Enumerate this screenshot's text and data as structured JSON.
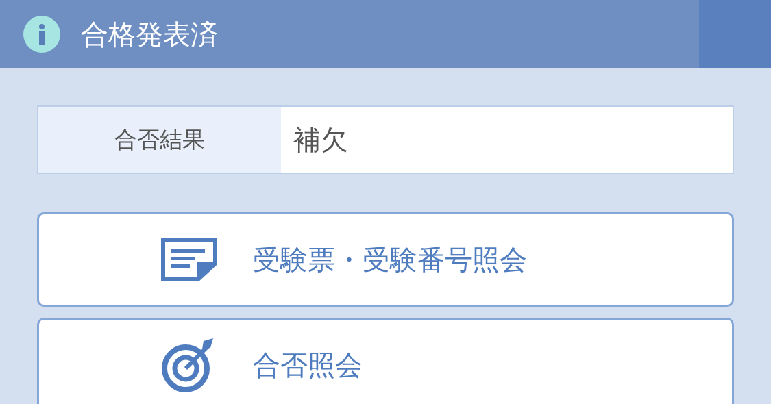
{
  "header": {
    "title": "合格発表済"
  },
  "result": {
    "label": "合否結果",
    "value": "補欠"
  },
  "buttons": [
    {
      "kind": "ticket",
      "label": "受験票・受験番号照会"
    },
    {
      "kind": "target",
      "label": "合否照会"
    }
  ]
}
